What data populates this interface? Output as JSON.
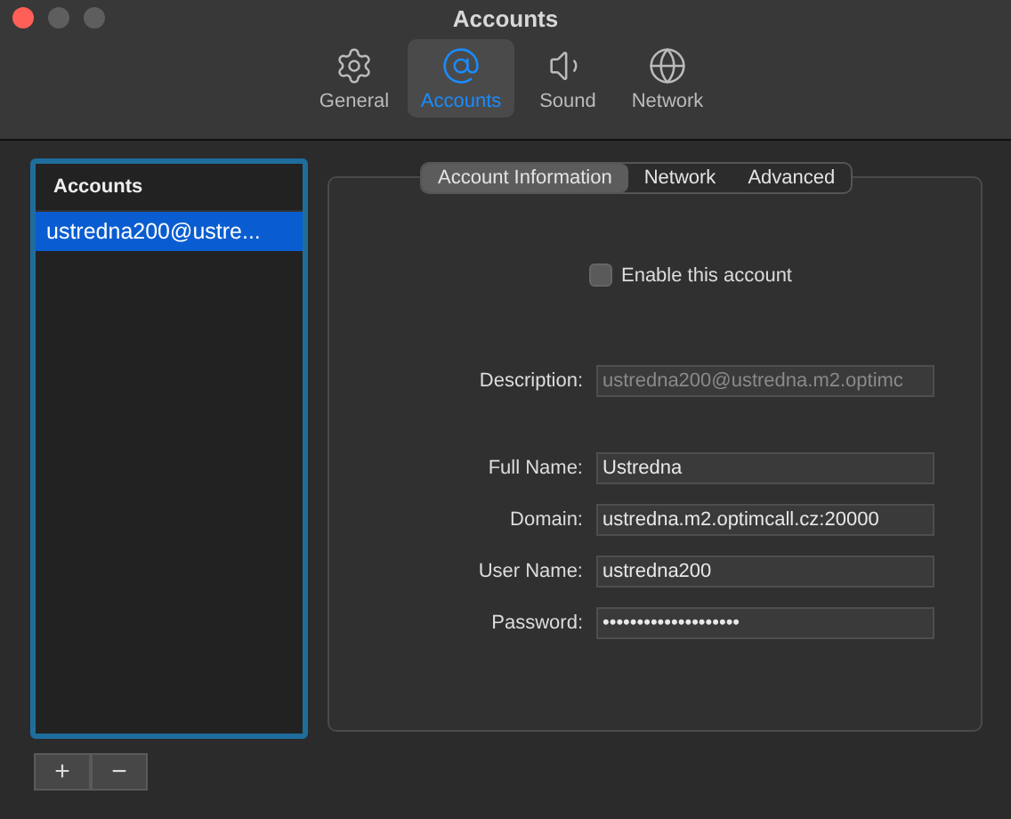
{
  "window": {
    "title": "Accounts"
  },
  "toolbar": [
    {
      "kind": "gear",
      "label": "General",
      "selected": false
    },
    {
      "kind": "at",
      "label": "Accounts",
      "selected": true
    },
    {
      "kind": "speaker",
      "label": "Sound",
      "selected": false
    },
    {
      "kind": "globe",
      "label": "Network",
      "selected": false
    }
  ],
  "accounts_list": {
    "header": "Accounts",
    "items": [
      {
        "label": "ustredna200@ustre...",
        "selected": true
      }
    ]
  },
  "list_buttons": [
    "+",
    "−"
  ],
  "tabs": [
    {
      "label": "Account Information",
      "selected": true
    },
    {
      "label": "Network",
      "selected": false
    },
    {
      "label": "Advanced",
      "selected": false
    }
  ],
  "enable_account": {
    "label": "Enable this account",
    "checked": false
  },
  "field_groups": [
    [
      {
        "label": "Description:",
        "value": "ustredna200@ustredna.m2.optimc",
        "disabled": true
      }
    ],
    [
      {
        "label": "Full Name:",
        "value": "Ustredna",
        "disabled": false
      },
      {
        "label": "Domain:",
        "value": "ustredna.m2.optimcall.cz:20000",
        "disabled": false
      },
      {
        "label": "User Name:",
        "value": "ustredna200",
        "disabled": false
      },
      {
        "label": "Password:",
        "value": "••••••••••••••••••••",
        "disabled": false
      }
    ]
  ]
}
